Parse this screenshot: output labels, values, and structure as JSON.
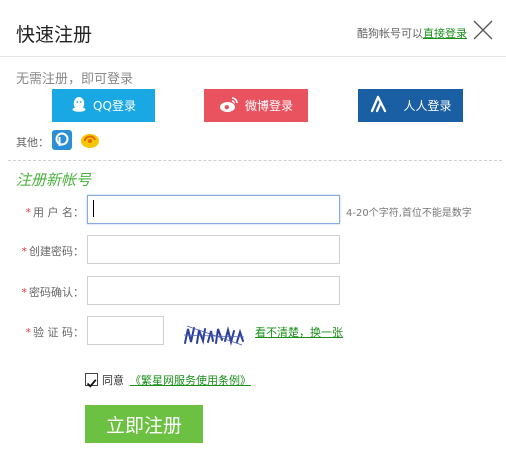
{
  "header": {
    "title": "快速注册",
    "login_hint": "酷狗帐号可以",
    "login_link": "直接登录"
  },
  "social": {
    "subtitle": "无需注册，即可登录",
    "buttons": [
      {
        "label": "QQ登录",
        "icon": "qq-penguin-icon",
        "color": "#19a8e3"
      },
      {
        "label": "微博登录",
        "icon": "weibo-icon",
        "color": "#e8535f"
      },
      {
        "label": "人人登录",
        "icon": "renren-icon",
        "color": "#1a5ea3"
      }
    ],
    "other_label": "其他："
  },
  "form": {
    "section_title": "注册新帐号",
    "required_mark": "*",
    "fields": {
      "username": {
        "label": "用 户 名：",
        "value": "",
        "hint": "4-20个字符,首位不能是数字"
      },
      "password": {
        "label": "创建密码：",
        "value": ""
      },
      "confirm": {
        "label": "密码确认：",
        "value": ""
      },
      "captcha": {
        "label": "验 证 码：",
        "value": "",
        "refresh_label": "看不清楚，换一张"
      }
    },
    "agree": {
      "checked": true,
      "label": "同意",
      "terms_link": "《繁星网服务使用条例》"
    },
    "submit_label": "立即注册"
  },
  "colors": {
    "accent_green": "#6cc142",
    "link_green": "#1a8f1a",
    "qq_blue": "#19a8e3",
    "weibo_red": "#e8535f",
    "renren_blue": "#1a5ea3"
  }
}
